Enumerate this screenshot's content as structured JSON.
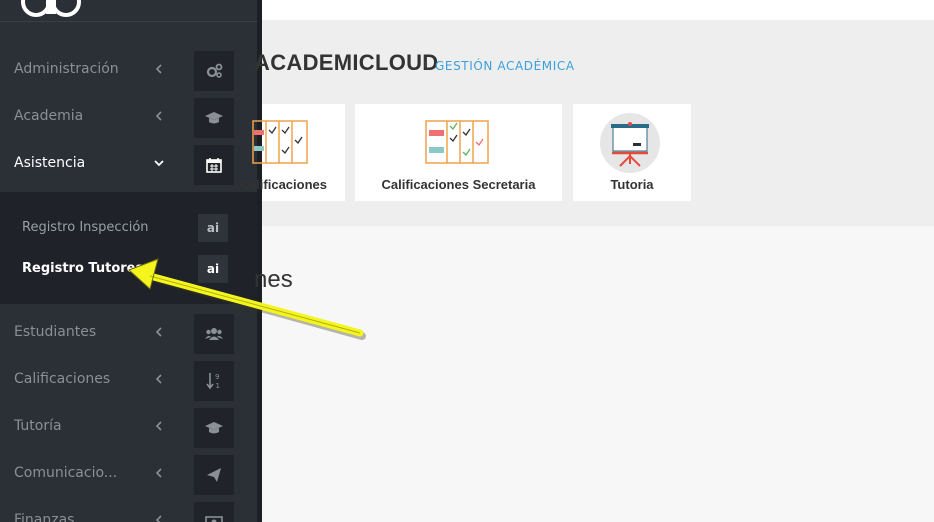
{
  "sidebar": {
    "items": [
      {
        "label": "Administración",
        "icon": "gears-icon"
      },
      {
        "label": "Academia",
        "icon": "graduation-cap-icon"
      },
      {
        "label": "Asistencia",
        "icon": "calendar-icon"
      },
      {
        "label": "Estudiantes",
        "icon": "users-icon"
      },
      {
        "label": "Calificaciones",
        "icon": "sort-numeric-icon"
      },
      {
        "label": "Tutoría",
        "icon": "graduation-cap-icon"
      },
      {
        "label": "Comunicacio...",
        "icon": "paper-plane-icon"
      },
      {
        "label": "Finanzas",
        "icon": "money-icon"
      }
    ],
    "submenu": [
      {
        "label": "Registro Inspección",
        "badge": "ai"
      },
      {
        "label": "Registro Tutores",
        "badge": "ai"
      }
    ]
  },
  "header": {
    "title": "ACADEMICLOUD",
    "separator": "›",
    "breadcrumb": "GESTIÓN ACADÉMICA"
  },
  "cards": [
    {
      "label": "Calificaciones"
    },
    {
      "label": "Calificaciones Secretaria"
    },
    {
      "label": "Tutoria"
    }
  ],
  "section": {
    "title": "nes"
  },
  "colors": {
    "accent_link": "#3aa0dd",
    "sidebar_bg": "#2b2f36",
    "annotation_arrow": "#f5f51e"
  }
}
